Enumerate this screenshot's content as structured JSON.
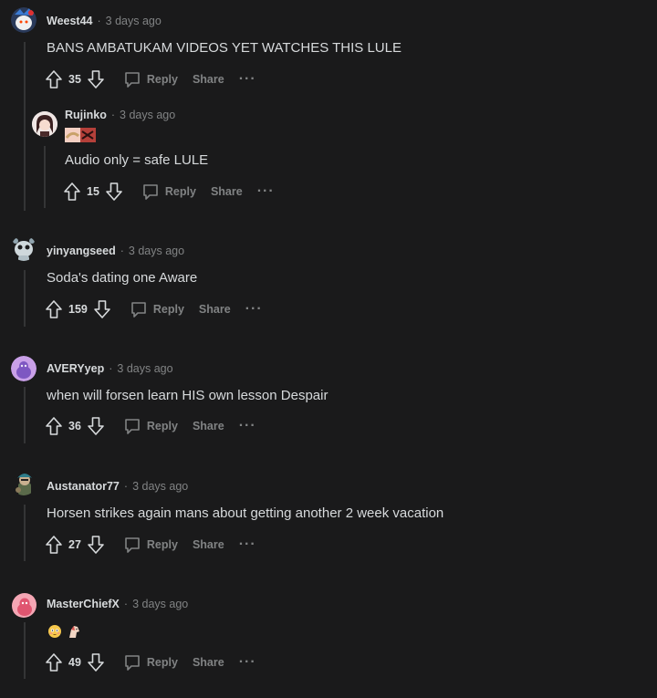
{
  "comments": [
    {
      "author": "Weest44",
      "sep": "·",
      "time": "3 days ago",
      "body": "BANS AMBATUKAM VIDEOS YET WATCHES THIS LULE",
      "votes": "35",
      "reply_label": "Reply",
      "share_label": "Share",
      "more_label": "···"
    },
    {
      "author": "Rujinko",
      "sep": "·",
      "time": "3 days ago",
      "body": "Audio only = safe LULE",
      "votes": "15",
      "reply_label": "Reply",
      "share_label": "Share",
      "more_label": "···"
    },
    {
      "author": "yinyangseed",
      "sep": "·",
      "time": "3 days ago",
      "body": "Soda's dating one Aware",
      "votes": "159",
      "reply_label": "Reply",
      "share_label": "Share",
      "more_label": "···"
    },
    {
      "author": "AVERYyep",
      "sep": "·",
      "time": "3 days ago",
      "body": "when will forsen learn HIS own lesson Despair",
      "votes": "36",
      "reply_label": "Reply",
      "share_label": "Share",
      "more_label": "···"
    },
    {
      "author": "Austanator77",
      "sep": "·",
      "time": "3 days ago",
      "body": "Horsen strikes again mans about getting another 2 week vacation",
      "votes": "27",
      "reply_label": "Reply",
      "share_label": "Share",
      "more_label": "···"
    },
    {
      "author": "MasterChiefX",
      "sep": "·",
      "time": "3 days ago",
      "body": "",
      "votes": "49",
      "reply_label": "Reply",
      "share_label": "Share",
      "more_label": "···"
    }
  ],
  "icons": {
    "upvote": "upvote-icon",
    "downvote": "downvote-icon",
    "reply": "comment-bubble-icon",
    "more": "more-options-icon"
  },
  "colors": {
    "background": "#1a1a1b",
    "text": "#d7dadc",
    "muted": "#818384",
    "thread_line": "#343536"
  }
}
